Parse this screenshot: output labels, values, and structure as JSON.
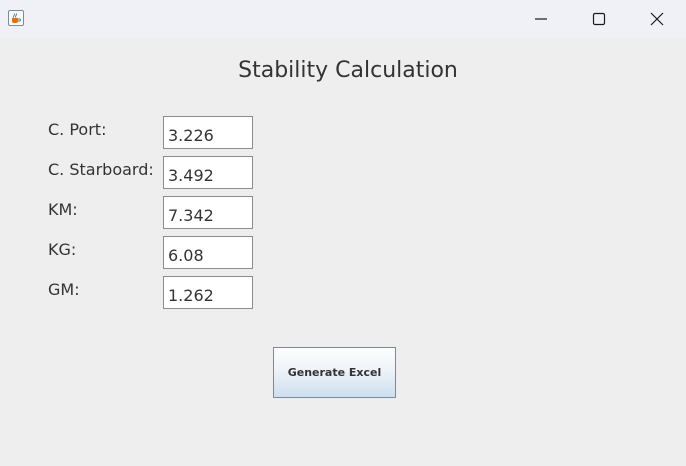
{
  "window": {
    "icon": "java-coffee-cup-icon",
    "controls": {
      "minimize_icon": "minimize-icon",
      "maximize_icon": "maximize-icon",
      "close_icon": "close-icon"
    }
  },
  "form": {
    "title": "Stability Calculation",
    "fields": [
      {
        "label": "C. Port:",
        "value": "3.226"
      },
      {
        "label": "C. Starboard:",
        "value": "3.492"
      },
      {
        "label": "KM:",
        "value": "7.342"
      },
      {
        "label": "KG:",
        "value": "6.08"
      },
      {
        "label": "GM:",
        "value": "1.262"
      }
    ],
    "generate_button_label": "Generate Excel"
  }
}
